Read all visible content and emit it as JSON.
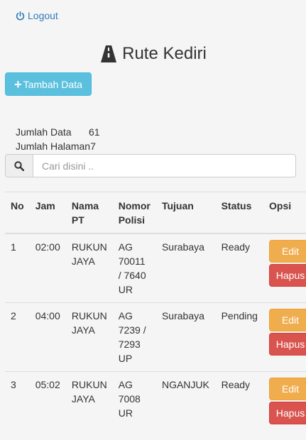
{
  "header": {
    "logout_label": "Logout",
    "title": "Rute Kediri"
  },
  "toolbar": {
    "add_label": "Tambah Data"
  },
  "stats": {
    "total_label": "Jumlah Data",
    "total_value": "61",
    "pages_label": "Jumlah Halaman",
    "pages_value": "7"
  },
  "search": {
    "placeholder": "Cari disini .."
  },
  "table": {
    "columns": [
      "No",
      "Jam",
      "Nama PT",
      "Nomor Polisi",
      "Tujuan",
      "Status",
      "Opsi"
    ],
    "edit_label": "Edit",
    "delete_label": "Hapus",
    "rows": [
      {
        "no": "1",
        "jam": "02:00",
        "pt": "RUKUN JAYA",
        "polisi": "AG 70011 / 7640 UR",
        "tujuan": "Surabaya",
        "status": "Ready"
      },
      {
        "no": "2",
        "jam": "04:00",
        "pt": "RUKUN JAYA",
        "polisi": "AG 7239 / 7293 UP",
        "tujuan": "Surabaya",
        "status": "Pending"
      },
      {
        "no": "3",
        "jam": "05:02",
        "pt": "RUKUN JAYA",
        "polisi": "AG 7008 UR",
        "tujuan": "NGANJUK",
        "status": "Ready"
      }
    ]
  },
  "colors": {
    "link": "#337ab7",
    "info": "#5bc0de",
    "warning": "#f0ad4e",
    "danger": "#d9534f"
  },
  "icons": {
    "logout": "power-icon",
    "title": "road-icon",
    "search": "search-icon",
    "add": "plus-icon"
  }
}
